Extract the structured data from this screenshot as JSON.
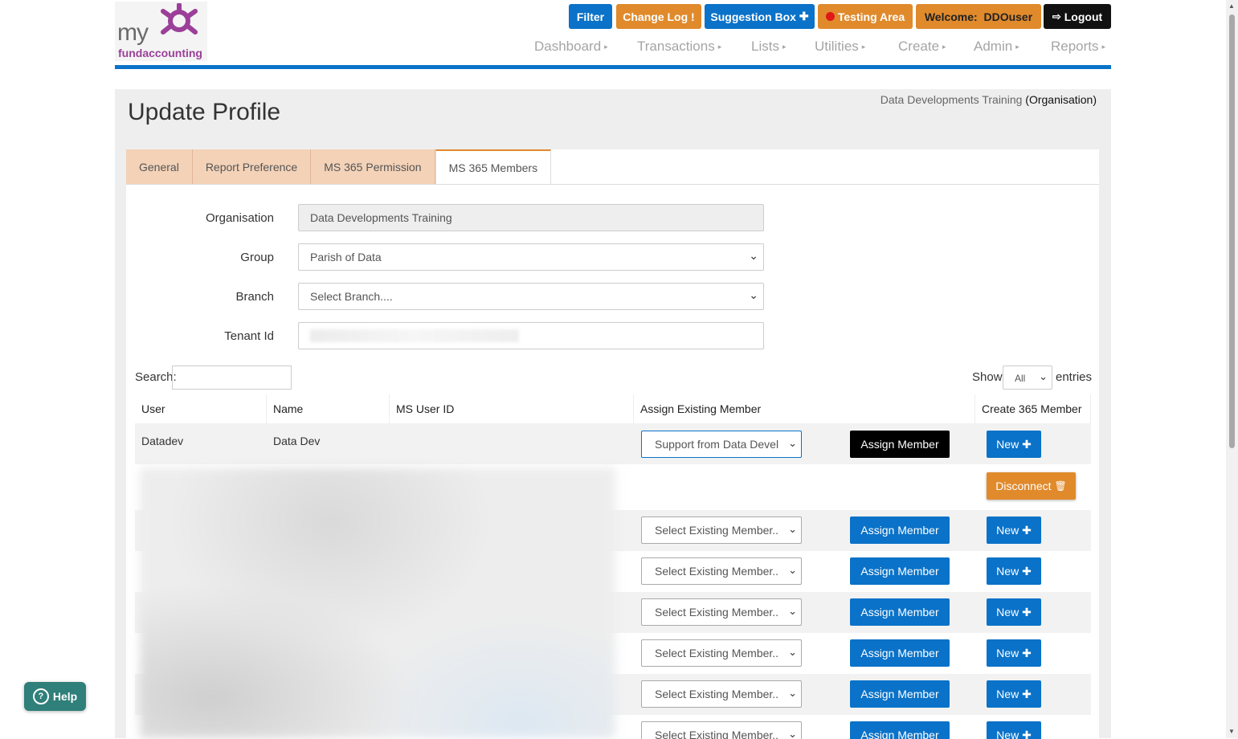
{
  "header": {
    "logo_my": "my",
    "logo_fund": "fundaccounting",
    "filter": "Filter",
    "change_log": "Change Log",
    "change_log_icon": "!",
    "suggestion_box": "Suggestion Box",
    "testing_area": "Testing Area",
    "welcome_label": "Welcome:",
    "welcome_user": "DDOuser",
    "logout": "Logout"
  },
  "menu": [
    {
      "label": "Dashboard"
    },
    {
      "label": "Transactions"
    },
    {
      "label": "Lists"
    },
    {
      "label": "Utilities"
    },
    {
      "label": "Create"
    },
    {
      "label": "Admin"
    },
    {
      "label": "Reports"
    }
  ],
  "page": {
    "title": "Update Profile",
    "org_name": "Data Developments Training",
    "org_type": "(Organisation)"
  },
  "tabs": [
    "General",
    "Report Preference",
    "MS 365 Permission",
    "MS 365 Members"
  ],
  "form": {
    "organisation_label": "Organisation",
    "organisation_value": "Data Developments Training",
    "group_label": "Group",
    "group_value": "Parish of Data",
    "branch_label": "Branch",
    "branch_value": "Select Branch....",
    "tenant_label": "Tenant Id"
  },
  "table_controls": {
    "search_label": "Search:",
    "show_label": "Show",
    "show_value": "All",
    "entries_label": "entries"
  },
  "table": {
    "headers": [
      "User",
      "Name",
      "MS User ID",
      "Assign Existing Member",
      "Create 365 Member"
    ],
    "first_row": {
      "user": "Datadev",
      "name": "Data Dev",
      "ms_user_id": "",
      "select": "Support from Data Devel",
      "assign": "Assign Member",
      "new": "New"
    },
    "disconnect": "Disconnect",
    "select_placeholder": "Select Existing Member..",
    "assign_label": "Assign Member",
    "new_label": "New"
  },
  "help": "Help",
  "colors": {
    "brand_blue": "#0a72c8",
    "brand_orange": "#e08a2c",
    "logo_purple": "#9b3f99"
  }
}
